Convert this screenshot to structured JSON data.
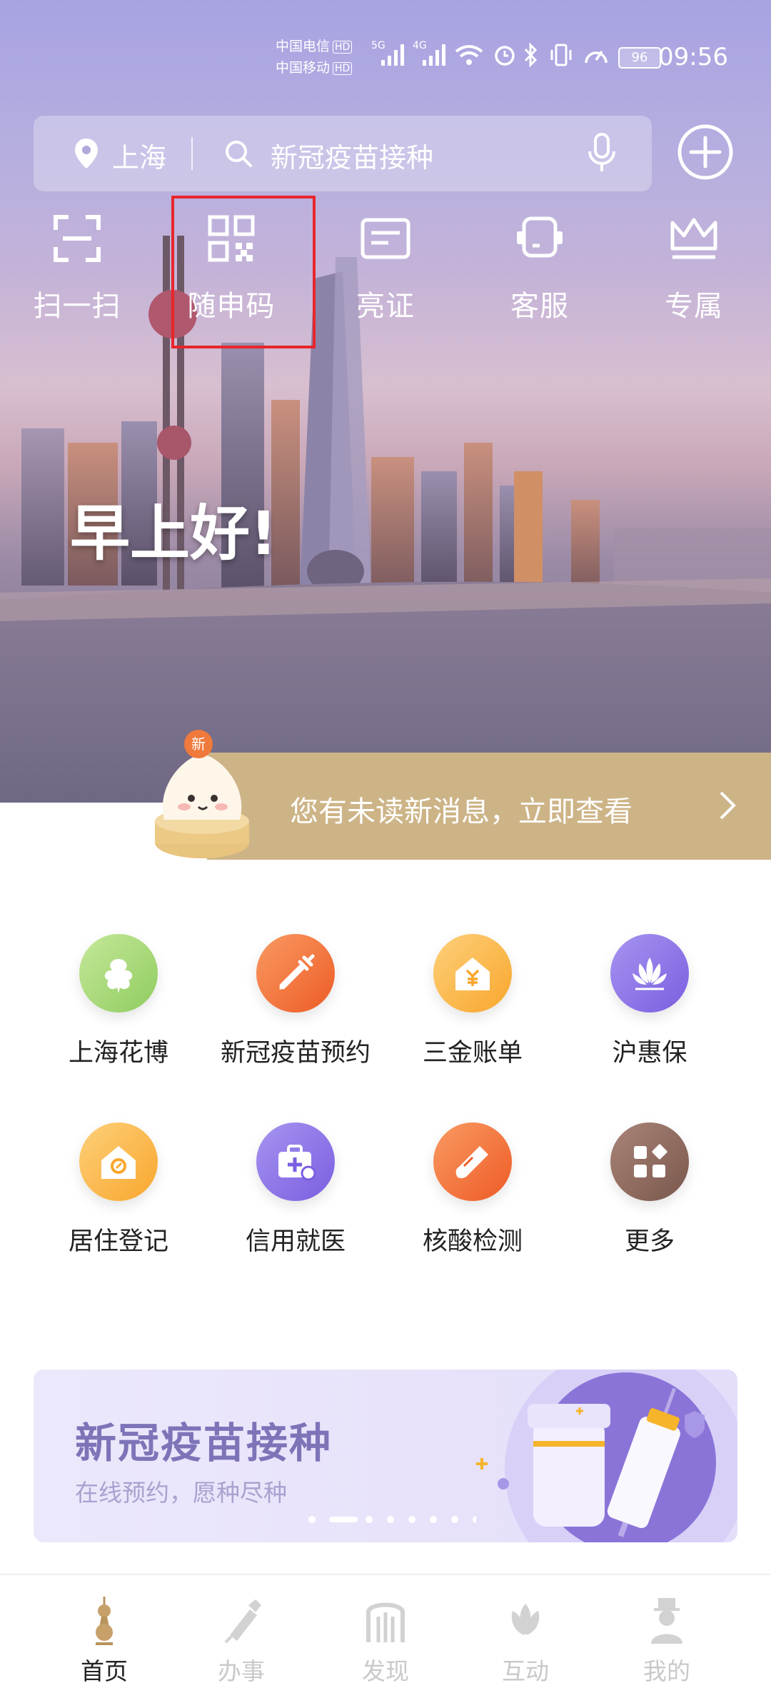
{
  "status_bar": {
    "carrier1": "中国电信",
    "carrier2": "中国移动",
    "hd": "HD",
    "net1": "5G",
    "net2": "4G",
    "battery": "96",
    "time": "09:56"
  },
  "search": {
    "city": "上海",
    "placeholder": "新冠疫苗接种"
  },
  "quick_actions": [
    {
      "label": "扫一扫"
    },
    {
      "label": "随申码"
    },
    {
      "label": "亮证"
    },
    {
      "label": "客服"
    },
    {
      "label": "专属"
    }
  ],
  "greeting": "早上好!",
  "notice": {
    "badge": "新",
    "text": "您有未读新消息，立即查看"
  },
  "services": [
    {
      "label": "上海花博",
      "color": "#9bd16a"
    },
    {
      "label": "新冠疫苗预约",
      "color": "#f36f32"
    },
    {
      "label": "三金账单",
      "color": "#fbb33e"
    },
    {
      "label": "沪惠保",
      "color": "#8b6ee6"
    },
    {
      "label": "居住登记",
      "color": "#fbb33e"
    },
    {
      "label": "信用就医",
      "color": "#8b6ee6"
    },
    {
      "label": "核酸检测",
      "color": "#f36f32"
    },
    {
      "label": "更多",
      "color": "#8c6659"
    }
  ],
  "banner": {
    "title": "新冠疫苗接种",
    "subtitle": "在线预约，愿种尽种",
    "page_count": 8,
    "active_page": 2
  },
  "tabs": [
    {
      "label": "首页",
      "active": true
    },
    {
      "label": "办事",
      "active": false
    },
    {
      "label": "发现",
      "active": false
    },
    {
      "label": "互动",
      "active": false
    },
    {
      "label": "我的",
      "active": false
    }
  ]
}
